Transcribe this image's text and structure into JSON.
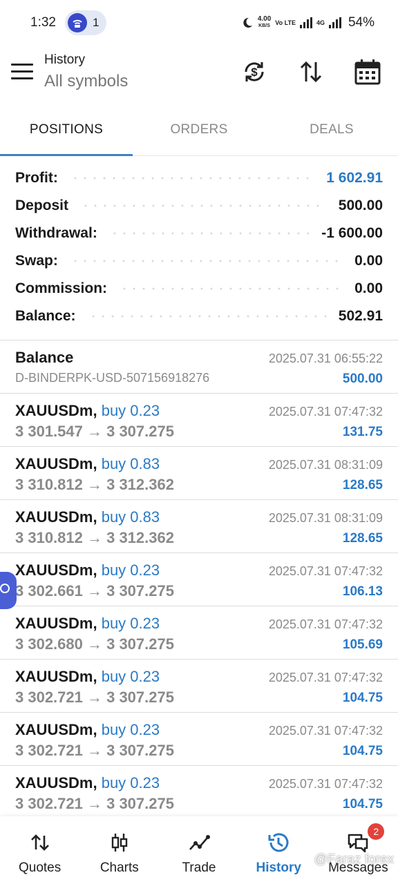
{
  "status_bar": {
    "time": "1:32",
    "notification_count": "1",
    "speed_value": "4.00",
    "speed_unit": "KB/S",
    "volte": "Vo LTE",
    "network": "4G",
    "battery": "54%"
  },
  "header": {
    "title": "History",
    "subtitle": "All symbols",
    "icons": [
      "menu-icon",
      "currency-exchange-icon",
      "sort-icon",
      "calendar-icon"
    ]
  },
  "tabs": [
    {
      "label": "POSITIONS",
      "active": true
    },
    {
      "label": "ORDERS",
      "active": false
    },
    {
      "label": "DEALS",
      "active": false
    }
  ],
  "summary": [
    {
      "label": "Profit:",
      "value": "1 602.91",
      "highlight": true
    },
    {
      "label": "Deposit",
      "value": "500.00",
      "highlight": false
    },
    {
      "label": "Withdrawal:",
      "value": "-1 600.00",
      "highlight": false
    },
    {
      "label": "Swap:",
      "value": "0.00",
      "highlight": false
    },
    {
      "label": "Commission:",
      "value": "0.00",
      "highlight": false
    },
    {
      "label": "Balance:",
      "value": "502.91",
      "highlight": false
    }
  ],
  "balance_entry": {
    "title": "Balance",
    "account": "D-BINDERPK-USD-507156918276",
    "time": "2025.07.31 06:55:22",
    "amount": "500.00"
  },
  "deals": [
    {
      "symbol": "XAUUSDm,",
      "side": "buy 0.23",
      "prices": "3 301.547 → 3 307.275",
      "time": "2025.07.31 07:47:32",
      "profit": "131.75"
    },
    {
      "symbol": "XAUUSDm,",
      "side": "buy 0.83",
      "prices": "3 310.812 → 3 312.362",
      "time": "2025.07.31 08:31:09",
      "profit": "128.65"
    },
    {
      "symbol": "XAUUSDm,",
      "side": "buy 0.83",
      "prices": "3 310.812 → 3 312.362",
      "time": "2025.07.31 08:31:09",
      "profit": "128.65"
    },
    {
      "symbol": "XAUUSDm,",
      "side": "buy 0.23",
      "prices": "3 302.661 → 3 307.275",
      "time": "2025.07.31 07:47:32",
      "profit": "106.13"
    },
    {
      "symbol": "XAUUSDm,",
      "side": "buy 0.23",
      "prices": "3 302.680 → 3 307.275",
      "time": "2025.07.31 07:47:32",
      "profit": "105.69"
    },
    {
      "symbol": "XAUUSDm,",
      "side": "buy 0.23",
      "prices": "3 302.721 → 3 307.275",
      "time": "2025.07.31 07:47:32",
      "profit": "104.75"
    },
    {
      "symbol": "XAUUSDm,",
      "side": "buy 0.23",
      "prices": "3 302.721 → 3 307.275",
      "time": "2025.07.31 07:47:32",
      "profit": "104.75"
    },
    {
      "symbol": "XAUUSDm,",
      "side": "buy 0.23",
      "prices": "3 302.721 → 3 307.275",
      "time": "2025.07.31 07:47:32",
      "profit": "104.75"
    }
  ],
  "bottom_nav": [
    {
      "label": "Quotes",
      "icon": "quotes-icon",
      "active": false
    },
    {
      "label": "Charts",
      "icon": "charts-icon",
      "active": false
    },
    {
      "label": "Trade",
      "icon": "trade-icon",
      "active": false
    },
    {
      "label": "History",
      "icon": "history-icon",
      "active": true
    },
    {
      "label": "Messages",
      "icon": "messages-icon",
      "active": false,
      "badge": "2"
    }
  ],
  "watermark": "@Faraz forex",
  "colors": {
    "accent": "#2a7ac6",
    "tab_indicator": "#3b82c9",
    "badge": "#e0433b",
    "muted_text": "#8a8a8a"
  }
}
